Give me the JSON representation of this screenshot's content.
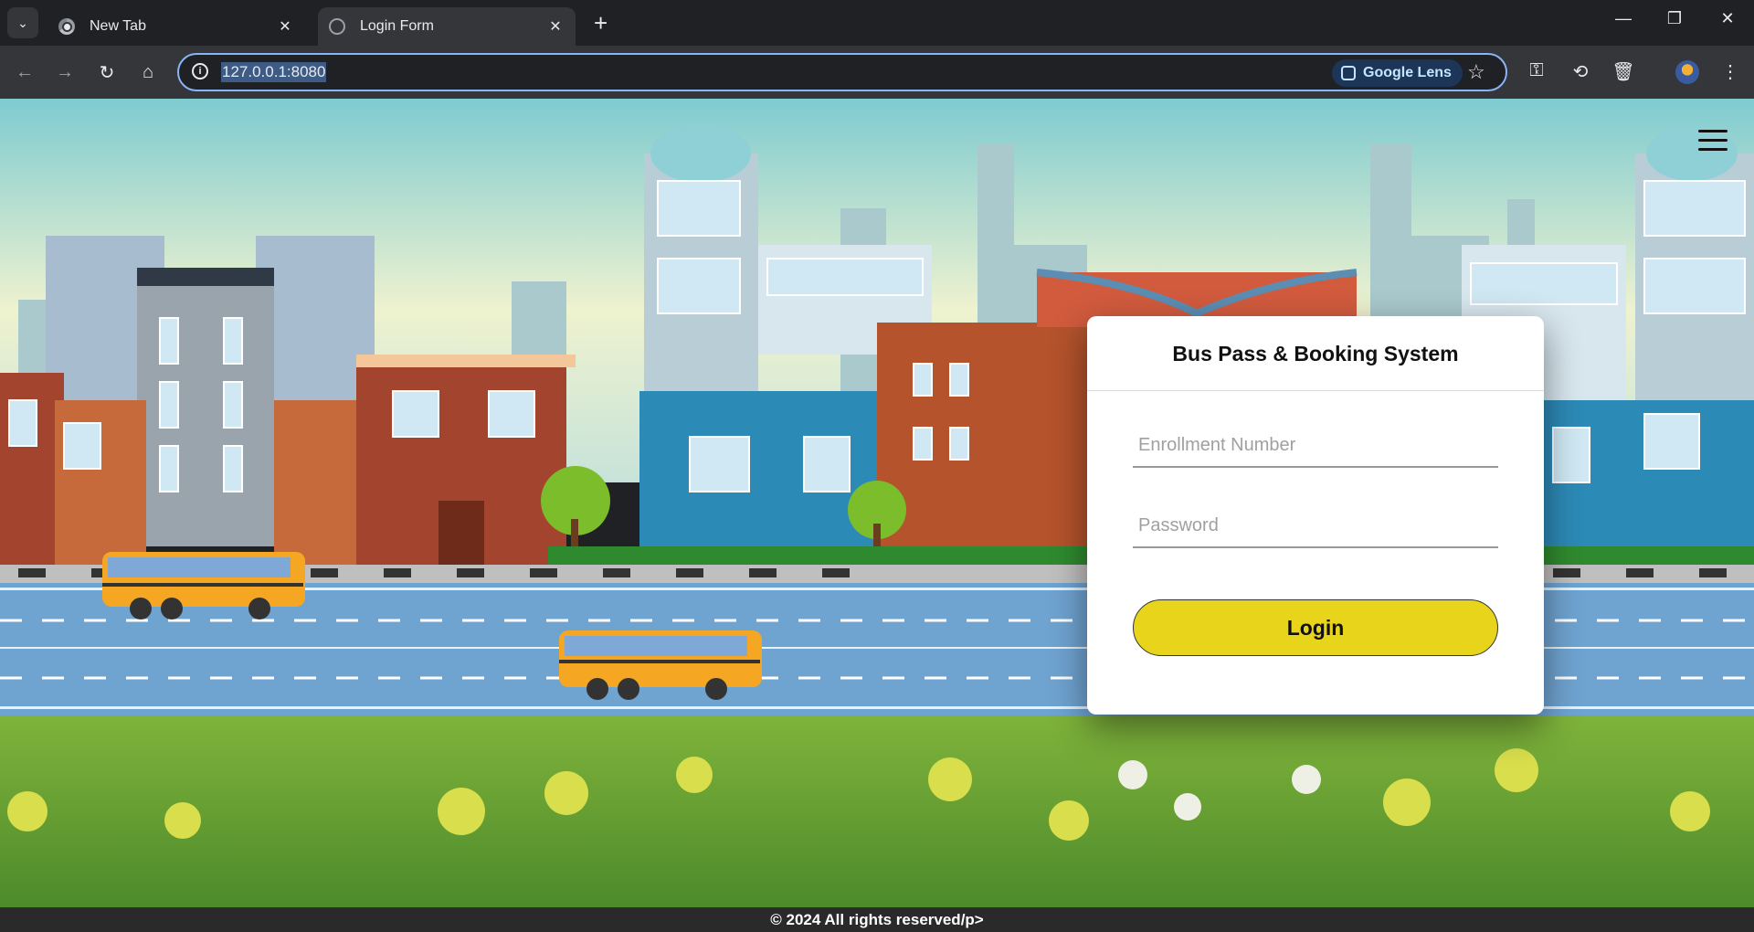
{
  "browser": {
    "tabs": [
      {
        "title": "New Tab",
        "active": false
      },
      {
        "title": "Login Form",
        "active": true
      }
    ],
    "url": "127.0.0.1:8080",
    "lens_label": "Google Lens"
  },
  "login": {
    "title": "Bus Pass & Booking System",
    "enrollment_placeholder": "Enrollment Number",
    "password_placeholder": "Password",
    "button_label": "Login"
  },
  "footer": {
    "text": "© 2024 All rights reserved/p>"
  },
  "colors": {
    "accent_button": "#e8d41a",
    "sky": "#9fd3d6",
    "road": "#6fa3d0",
    "bus": "#f5a623"
  }
}
